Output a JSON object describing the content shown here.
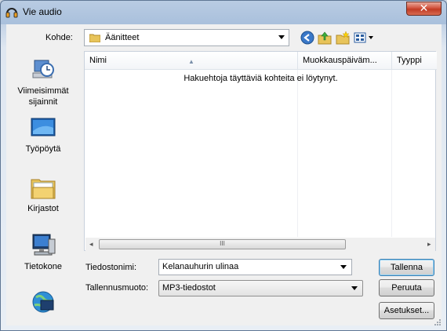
{
  "window": {
    "title": "Vie audio",
    "close_label": "✕"
  },
  "location": {
    "label": "Kohde:",
    "value": "Äänitteet"
  },
  "toolbar": {
    "icons": [
      "back-icon",
      "up-folder-icon",
      "new-folder-icon",
      "views-menu-icon"
    ]
  },
  "places": [
    {
      "label": "Viimeisimmät sijainnit",
      "icon": "recent-places-icon"
    },
    {
      "label": "Työpöytä",
      "icon": "desktop-icon"
    },
    {
      "label": "Kirjastot",
      "icon": "libraries-icon"
    },
    {
      "label": "Tietokone",
      "icon": "computer-icon"
    },
    {
      "label": "",
      "icon": "network-icon"
    }
  ],
  "filelist": {
    "columns": [
      "Nimi",
      "Muokkauspäiväm...",
      "Tyyppi"
    ],
    "empty_message": "Hakuehtoja täyttäviä kohteita ei löytynyt.",
    "scroll_grip": "III"
  },
  "filename": {
    "label": "Tiedostonimi:",
    "value": "Kelanauhurin ulinaa"
  },
  "format": {
    "label": "Tallennusmuoto:",
    "value": "MP3-tiedostot"
  },
  "buttons": {
    "save": "Tallenna",
    "cancel": "Peruuta",
    "options": "Asetukset..."
  }
}
